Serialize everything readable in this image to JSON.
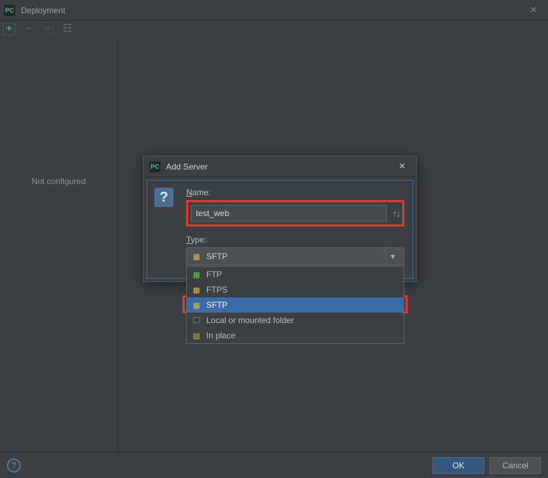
{
  "window": {
    "title": "Deployment",
    "close_glyph": "×"
  },
  "toolbar": {
    "add_glyph": "+",
    "remove_glyph": "−",
    "copy_glyph": "⿻",
    "paste_glyph": "☷"
  },
  "sidebar": {
    "empty_text": "Not configured"
  },
  "footer": {
    "help_glyph": "?",
    "ok_label": "OK",
    "cancel_label": "Cancel"
  },
  "dialog": {
    "title": "Add Server",
    "help_glyph": "?",
    "close_glyph": "×",
    "name_label_pre": "N",
    "name_label_rest": "ame:",
    "name_value": "test_web",
    "sort_glyph": "↑↓",
    "type_label_pre": "T",
    "type_label_rest": "ype:",
    "selected_type": "SFTP",
    "combo_icon_glyph": "▦",
    "combo_arrow_glyph": "▾",
    "options": [
      {
        "label": "FTP",
        "icon_glyph": "▦",
        "icon_class": "ic-green"
      },
      {
        "label": "FTPS",
        "icon_glyph": "▦",
        "icon_class": "ic-gold"
      },
      {
        "label": "SFTP",
        "icon_glyph": "▦",
        "icon_class": "ic-gold",
        "selected": true
      },
      {
        "label": "Local or mounted folder",
        "icon_glyph": "🖵",
        "icon_class": "ic-grey"
      },
      {
        "label": "In place",
        "icon_glyph": "▤",
        "icon_class": "ic-gold"
      }
    ]
  }
}
